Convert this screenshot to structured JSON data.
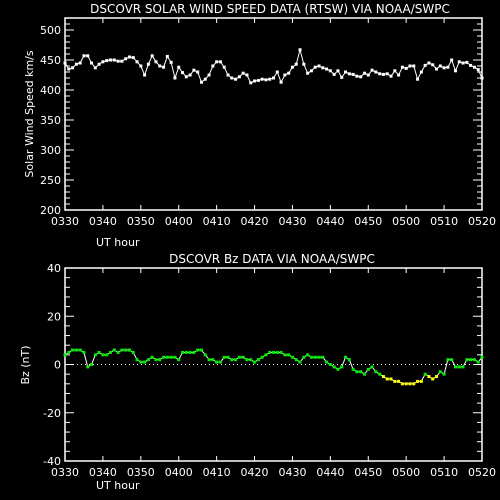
{
  "chart_data": [
    {
      "type": "line",
      "title": "DSCOVR SOLAR WIND SPEED DATA (RTSW) VIA NOAA/SWPC",
      "xlabel": "UT hour",
      "ylabel": "Solar Wind Speed km/s",
      "xlim": [
        0,
        110
      ],
      "ylim": [
        200,
        520
      ],
      "x_tick_labels": [
        "0330",
        "0340",
        "0350",
        "0400",
        "0410",
        "0420",
        "0430",
        "0440",
        "0450",
        "0500",
        "0510",
        "0520"
      ],
      "y_tick_labels": [
        "200",
        "250",
        "300",
        "350",
        "400",
        "450",
        "500"
      ],
      "y_tick_values": [
        200,
        250,
        300,
        350,
        400,
        450,
        500
      ],
      "line_color": "#ffffff",
      "x": [
        0,
        1,
        2,
        3,
        4,
        5,
        6,
        7,
        8,
        9,
        10,
        11,
        12,
        13,
        14,
        15,
        16,
        17,
        18,
        19,
        20,
        21,
        22,
        23,
        24,
        25,
        26,
        27,
        28,
        29,
        30,
        31,
        32,
        33,
        34,
        35,
        36,
        37,
        38,
        39,
        40,
        41,
        42,
        43,
        44,
        45,
        46,
        47,
        48,
        49,
        50,
        51,
        52,
        53,
        54,
        55,
        56,
        57,
        58,
        59,
        60,
        61,
        62,
        63,
        64,
        65,
        66,
        67,
        68,
        69,
        70,
        71,
        72,
        73,
        74,
        75,
        76,
        77,
        78,
        79,
        80,
        81,
        82,
        83,
        84,
        85,
        86,
        87,
        88,
        89,
        90,
        91,
        92,
        93,
        94,
        95,
        96,
        97,
        98,
        99,
        100,
        101,
        102,
        103,
        104,
        105,
        106,
        107,
        108,
        109,
        110
      ],
      "values": [
        445,
        435,
        437,
        443,
        445,
        457,
        457,
        445,
        437,
        443,
        447,
        449,
        450,
        450,
        448,
        448,
        452,
        455,
        454,
        447,
        440,
        425,
        443,
        457,
        447,
        440,
        438,
        456,
        446,
        420,
        438,
        429,
        422,
        425,
        433,
        430,
        413,
        418,
        425,
        440,
        447,
        447,
        438,
        425,
        420,
        418,
        422,
        428,
        425,
        412,
        415,
        416,
        418,
        417,
        418,
        420,
        430,
        413,
        425,
        428,
        438,
        443,
        467,
        443,
        428,
        432,
        438,
        440,
        437,
        435,
        432,
        426,
        432,
        421,
        430,
        427,
        426,
        423,
        422,
        428,
        425,
        433,
        430,
        427,
        426,
        427,
        423,
        432,
        425,
        438,
        436,
        440,
        440,
        418,
        430,
        441,
        445,
        442,
        435,
        440,
        437,
        438,
        450,
        432,
        447,
        445,
        446,
        441,
        438,
        434,
        420
      ]
    },
    {
      "type": "line",
      "title": "DSCOVR Bz DATA VIA NOAA/SWPC",
      "xlabel": "UT hour",
      "ylabel": "Bz (nT)",
      "xlim": [
        0,
        110
      ],
      "ylim": [
        -40,
        40
      ],
      "x_tick_labels": [
        "0330",
        "0340",
        "0350",
        "0400",
        "0410",
        "0420",
        "0430",
        "0440",
        "0450",
        "0500",
        "0510",
        "0520"
      ],
      "y_tick_labels": [
        "40",
        "20",
        "0",
        "-20",
        "-40"
      ],
      "y_tick_values": [
        40,
        20,
        0,
        -20,
        -40
      ],
      "zero_line": true,
      "positive_color": "#00ee00",
      "negative_color": "#ffff00",
      "threshold_note": "points colored yellow when Bz below about -5 nT",
      "x": [
        0,
        1,
        2,
        3,
        4,
        5,
        6,
        7,
        8,
        9,
        10,
        11,
        12,
        13,
        14,
        15,
        16,
        17,
        18,
        19,
        20,
        21,
        22,
        23,
        24,
        25,
        26,
        27,
        28,
        29,
        30,
        31,
        32,
        33,
        34,
        35,
        36,
        37,
        38,
        39,
        40,
        41,
        42,
        43,
        44,
        45,
        46,
        47,
        48,
        49,
        50,
        51,
        52,
        53,
        54,
        55,
        56,
        57,
        58,
        59,
        60,
        61,
        62,
        63,
        64,
        65,
        66,
        67,
        68,
        69,
        70,
        71,
        72,
        73,
        74,
        75,
        76,
        77,
        78,
        79,
        80,
        81,
        82,
        83,
        84,
        85,
        86,
        87,
        88,
        89,
        90,
        91,
        92,
        93,
        94,
        95,
        96,
        97,
        98,
        99,
        100,
        101,
        102,
        103,
        104,
        105,
        106,
        107,
        108,
        109,
        110
      ],
      "values": [
        4,
        5,
        6,
        6,
        6,
        5,
        -1,
        0,
        4,
        5,
        4,
        4,
        5,
        6,
        5,
        6,
        6,
        6,
        5,
        2,
        1,
        1,
        2,
        3,
        2,
        2,
        3,
        3,
        3,
        3,
        2,
        5,
        5,
        5,
        5,
        6,
        6,
        4,
        2,
        2,
        1,
        1,
        3,
        3,
        2,
        2,
        3,
        3,
        2,
        2,
        1,
        2,
        3,
        4,
        5,
        5,
        5,
        5,
        4,
        4,
        3,
        2,
        1,
        3,
        4,
        3,
        3,
        3,
        3,
        1,
        0,
        -1,
        -2,
        -1,
        3,
        2,
        -2,
        -3,
        -3,
        -4,
        -2,
        -1,
        -3,
        -4,
        -5,
        -6,
        -6,
        -7,
        -7,
        -8,
        -8,
        -8,
        -8,
        -7,
        -7,
        -4,
        -5,
        -6,
        -5,
        -3,
        -4,
        2,
        2,
        -1,
        -1,
        -1,
        2,
        2,
        2,
        1,
        3
      ]
    }
  ]
}
